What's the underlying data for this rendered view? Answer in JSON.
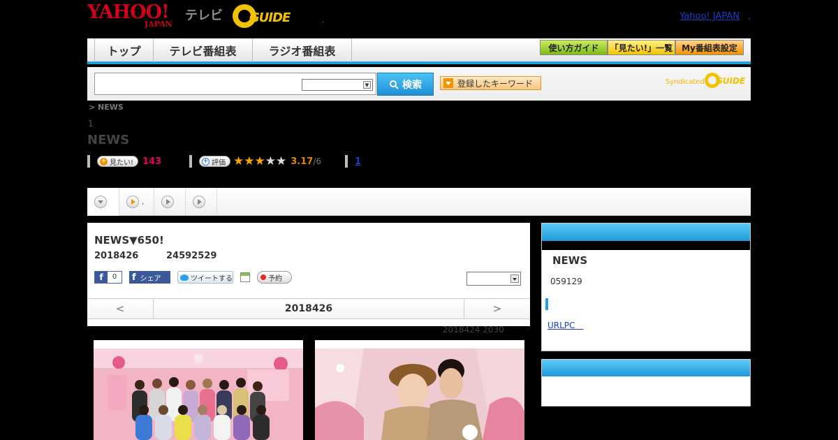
{
  "header": {
    "yahoo_logo": "YAHOO!",
    "yahoo_sub": "JAPAN",
    "tv_label": "テレビ",
    "gguide_logo": "GUIDE",
    "dot": ",",
    "yahoo_japan_link": "Yahoo! JAPAN",
    "yahoo_japan_suffix": ","
  },
  "nav": {
    "tabs": [
      "トップ",
      "テレビ番組表",
      "ラジオ番組表"
    ],
    "buttons": [
      "使い方ガイド",
      "「見たい!」一覧",
      "My番組表設定"
    ]
  },
  "search": {
    "query": "",
    "select_value": "",
    "button_label": "検索",
    "keyword_button_label": "登録したキーワード",
    "syndicated_label": "Syndicated",
    "syndicated_logo": "GUIDE"
  },
  "breadcrumb": "> NEWS",
  "subnum": "1",
  "page_title": "NEWS",
  "meta": {
    "want_label": "見たい!",
    "want_count": "143",
    "rate_label": "評価",
    "rating": 3.17,
    "rating_text": "3.17",
    "rating_of": "/6",
    "stars_on": 3,
    "stars_total": 5,
    "link_label": "1"
  },
  "tabs": [
    {
      "label": "",
      "icon": "down-arrow-icon"
    },
    {
      "label": ",",
      "icon": "play-icon"
    },
    {
      "label": "",
      "icon": "play-icon"
    },
    {
      "label": "",
      "icon": "play-icon"
    }
  ],
  "program": {
    "title": "NEWS▼650!",
    "date": "2018426",
    "time": "24592529",
    "fb_like_count": "0",
    "fb_share_label": "シェア",
    "tweet_label": "ツイートする",
    "reserve_label": "予約",
    "select_value": ""
  },
  "datenav": {
    "prev": "<",
    "date": "2018426",
    "next": ">"
  },
  "updated": "2018424  2030",
  "sidebar": {
    "title": "NEWS",
    "time": "059129",
    "link": "URLPC　"
  },
  "colors": {
    "accent": "#22a0df",
    "want_count": "#e4005d",
    "rating": "#e08600",
    "star": "#f5a800"
  }
}
